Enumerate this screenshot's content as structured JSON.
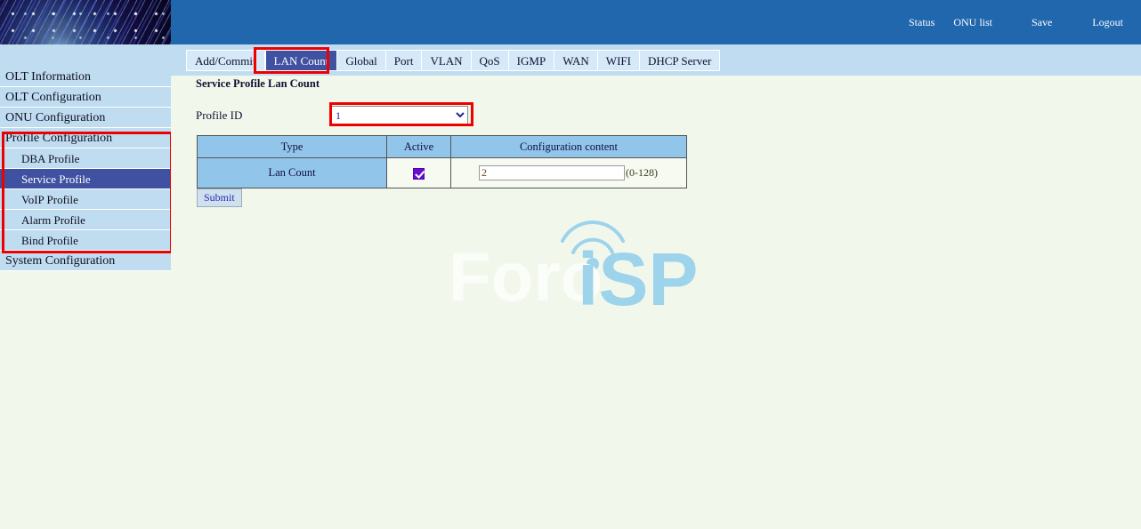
{
  "topnav": {
    "items": [
      {
        "label": "Status",
        "name": "status"
      },
      {
        "label": "ONU list",
        "name": "onu-list"
      },
      {
        "label": "Save",
        "name": "save"
      },
      {
        "label": "Logout",
        "name": "logout"
      }
    ]
  },
  "sidebar": {
    "items": [
      {
        "label": "OLT Information",
        "sub": false,
        "active": false
      },
      {
        "label": "OLT Configuration",
        "sub": false,
        "active": false
      },
      {
        "label": "ONU Configuration",
        "sub": false,
        "active": false
      },
      {
        "label": "Profile Configuration",
        "sub": false,
        "active": false
      },
      {
        "label": "DBA Profile",
        "sub": true,
        "active": false
      },
      {
        "label": "Service Profile",
        "sub": true,
        "active": true
      },
      {
        "label": "VoIP Profile",
        "sub": true,
        "active": false
      },
      {
        "label": "Alarm Profile",
        "sub": true,
        "active": false
      },
      {
        "label": "Bind Profile",
        "sub": true,
        "active": false
      },
      {
        "label": "System Configuration",
        "sub": false,
        "active": false
      }
    ]
  },
  "tabs": [
    {
      "label": "Add/Commit",
      "selected": false
    },
    {
      "label": "LAN Count",
      "selected": true
    },
    {
      "label": "Global",
      "selected": false
    },
    {
      "label": "Port",
      "selected": false
    },
    {
      "label": "VLAN",
      "selected": false
    },
    {
      "label": "QoS",
      "selected": false
    },
    {
      "label": "IGMP",
      "selected": false
    },
    {
      "label": "WAN",
      "selected": false
    },
    {
      "label": "WIFI",
      "selected": false
    },
    {
      "label": "DHCP Server",
      "selected": false
    }
  ],
  "main": {
    "page_title": "Service Profile Lan Count",
    "profile_id_label": "Profile ID",
    "profile_id_value": "1",
    "profile_id_options": [
      "1"
    ],
    "table": {
      "headers": [
        "Type",
        "Active",
        "Configuration content"
      ],
      "rows": [
        {
          "type": "Lan Count",
          "active": true,
          "value": "2",
          "hint": "(0-128)"
        }
      ]
    },
    "submit_label": "Submit"
  },
  "watermark": {
    "text_light": "Foro",
    "text_blue": "iSP",
    "color_light": "#fbfdf8",
    "color_blue": "#9ed3ec"
  },
  "colors": {
    "topbar": "#2067ae",
    "tabbar": "#bfdcf0",
    "selected": "#3f51a0",
    "highlight": "#ee0000",
    "table_header": "#92c5ea",
    "page_bg": "#f2f7ec"
  }
}
